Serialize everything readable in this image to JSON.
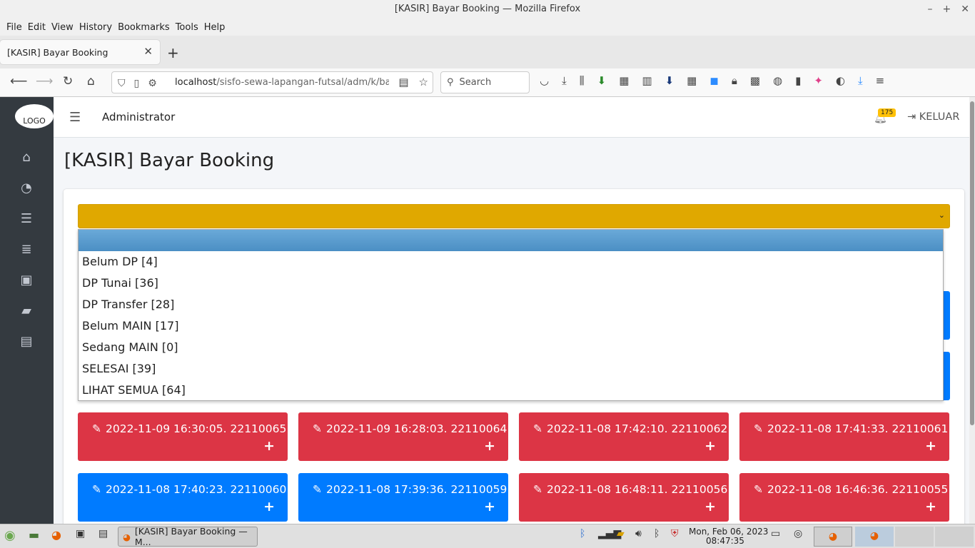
{
  "window": {
    "title": "[KASIR] Bayar Booking — Mozilla Firefox",
    "minimize": "–",
    "maximize": "+",
    "close": "✕"
  },
  "menu": [
    "File",
    "Edit",
    "View",
    "History",
    "Bookmarks",
    "Tools",
    "Help"
  ],
  "tab": {
    "title": "[KASIR] Bayar Booking",
    "close": "✕",
    "new": "+"
  },
  "nav": {
    "url_host": "localhost",
    "url_path": "/sisfo-sewa-lapangan-futsal/adm/k/baya",
    "search_placeholder": "Search"
  },
  "sidebar": {
    "logo": "LOGO",
    "icons": [
      "home-icon",
      "dashboard-icon",
      "server-icon",
      "database-icon",
      "money-icon",
      "book-icon",
      "archive-icon"
    ]
  },
  "header": {
    "admin_label": "Administrator",
    "notif_count": "175",
    "logout_label": "KELUAR"
  },
  "page": {
    "title": "[KASIR] Bayar Booking"
  },
  "status_select": {
    "selected": "",
    "options": [
      "Belum DP [4]",
      "DP Tunai [36]",
      "DP Transfer [28]",
      "Belum MAIN [17]",
      "Sedang MAIN [0]",
      "SELESAI [39]",
      "LIHAT SEMUA [64]"
    ]
  },
  "bookings": [
    {
      "label": "2022-11-09 16:30:05. 22110065",
      "status": "red"
    },
    {
      "label": "2022-11-09 16:28:03. 22110064",
      "status": "red"
    },
    {
      "label": "2022-11-08 17:42:10. 22110062",
      "status": "red"
    },
    {
      "label": "2022-11-08 17:41:33. 22110061",
      "status": "red"
    },
    {
      "label": "2022-11-08 17:40:23. 22110060",
      "status": "blue"
    },
    {
      "label": "2022-11-08 17:39:36. 22110059",
      "status": "blue"
    },
    {
      "label": "2022-11-08 16:48:11. 22110056",
      "status": "red"
    },
    {
      "label": "2022-11-08 16:46:36. 22110055",
      "status": "red"
    }
  ],
  "plus": "+",
  "colors": {
    "red": "#dc3545",
    "blue": "#007bff",
    "warning": "#e0a800",
    "sidebar": "#343a40"
  },
  "taskbar": {
    "window_title": "[KASIR] Bayar Booking — M...",
    "date": "Mon, Feb 06, 2023",
    "time": "08:47:35"
  }
}
